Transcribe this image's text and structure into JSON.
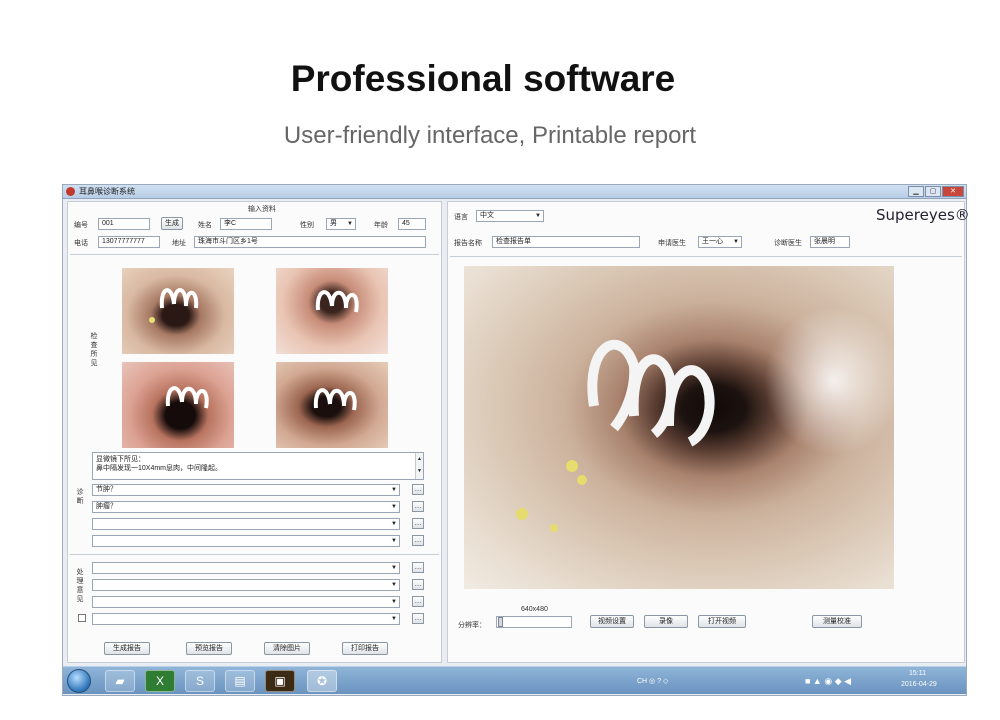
{
  "hero": {
    "title": "Professional software",
    "subtitle": "User-friendly interface, Printable report"
  },
  "window": {
    "title": "耳鼻喉诊断系统",
    "buttons": [
      "▁",
      "▢",
      "✕"
    ]
  },
  "left": {
    "section_title": "输入资料",
    "id_label": "编号",
    "id_value": "001",
    "generate_label": "生成",
    "name_label": "姓名",
    "name_value": "李C",
    "gender_label": "性别",
    "gender_value": "男",
    "age_label": "年龄",
    "age_value": "45",
    "phone_label": "电话",
    "phone_value": "13077777777",
    "address_label": "地址",
    "address_value": "珠海市斗门区乡1号",
    "exam_label": "检查所见",
    "findings_line1": "显微镜下所见：",
    "findings_line2": "鼻中隔发现一10X4mm息肉，中间隆起。",
    "diagnosis_label": "诊断",
    "diagnosis": [
      "节肿？",
      "肿瘤？",
      "",
      ""
    ],
    "treatment_label": "处理意见",
    "treatment": [
      "",
      "",
      "",
      ""
    ],
    "minus_label": "…",
    "bottom_buttons": [
      "生成报告",
      "预览报告",
      "清除图片",
      "打印报告"
    ]
  },
  "right": {
    "lang_label": "语言",
    "lang_value": "中文",
    "logo": "Supereyes®",
    "report_label": "报告名称",
    "report_value": "检查报告单",
    "doctor_label": "申请医生",
    "doctor_value": "王一心",
    "diag_doctor_label": "诊断医生",
    "diag_doctor_value": "张晨明",
    "resolution": "640x480",
    "resolution_label": "分辨率：",
    "buttons": [
      "视频设置",
      "录像",
      "打开视频",
      "测量校准"
    ]
  },
  "taskbar": {
    "time": "15:11",
    "date": "2016-04-29",
    "tray_text": "CH ◎ ? ◇"
  },
  "colors": {
    "window_bg": "#e9edf2",
    "titlebar": "#b8cde6",
    "taskbar": "#6a93bf",
    "accent_close": "#c9473a"
  },
  "icons": {
    "start": "windows-start-icon",
    "apps": [
      "folder-icon",
      "excel-icon",
      "skype-icon",
      "explorer-icon",
      "media-icon",
      "app-icon"
    ]
  }
}
